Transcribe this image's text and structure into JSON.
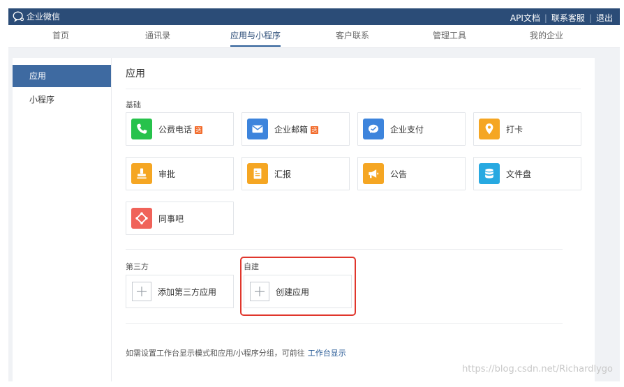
{
  "topbar": {
    "logo_text": "企业微信",
    "links": [
      "API文档",
      "联系客服",
      "退出"
    ]
  },
  "nav": {
    "items": [
      "首页",
      "通讯录",
      "应用与小程序",
      "客户联系",
      "管理工具",
      "我的企业"
    ],
    "active": "应用与小程序"
  },
  "sidebar": {
    "items": [
      "应用",
      "小程序"
    ],
    "active": "应用"
  },
  "main": {
    "title": "应用",
    "basic_label": "基础",
    "basic_apps": [
      {
        "label": "公费电话",
        "badge": "送",
        "icon": "phone-icon",
        "color": "#27c24c"
      },
      {
        "label": "企业邮箱",
        "badge": "送",
        "icon": "mail-icon",
        "color": "#3d84dc"
      },
      {
        "label": "企业支付",
        "badge": "",
        "icon": "payment-icon",
        "color": "#3d84dc"
      },
      {
        "label": "打卡",
        "badge": "",
        "icon": "location-pin-icon",
        "color": "#f5a623"
      },
      {
        "label": "审批",
        "badge": "",
        "icon": "stamp-icon",
        "color": "#f5a623"
      },
      {
        "label": "汇报",
        "badge": "",
        "icon": "document-icon",
        "color": "#f5a623"
      },
      {
        "label": "公告",
        "badge": "",
        "icon": "megaphone-icon",
        "color": "#f5a623"
      },
      {
        "label": "文件盘",
        "badge": "",
        "icon": "database-icon",
        "color": "#27a9e1"
      },
      {
        "label": "同事吧",
        "badge": "",
        "icon": "network-icon",
        "color": "#f0635a"
      }
    ],
    "third_party_label": "第三方",
    "add_third_party": "添加第三方应用",
    "custom_label": "自建",
    "create_app": "创建应用",
    "footer_text": "如需设置工作台显示模式和应用/小程序分组，可前往",
    "footer_link": "工作台显示"
  },
  "watermark": "https://blog.csdn.net/Richardlygo",
  "colors": {
    "header_bg": "#2b4c77",
    "accent": "#3e6aa1",
    "highlight": "#e0362c"
  }
}
